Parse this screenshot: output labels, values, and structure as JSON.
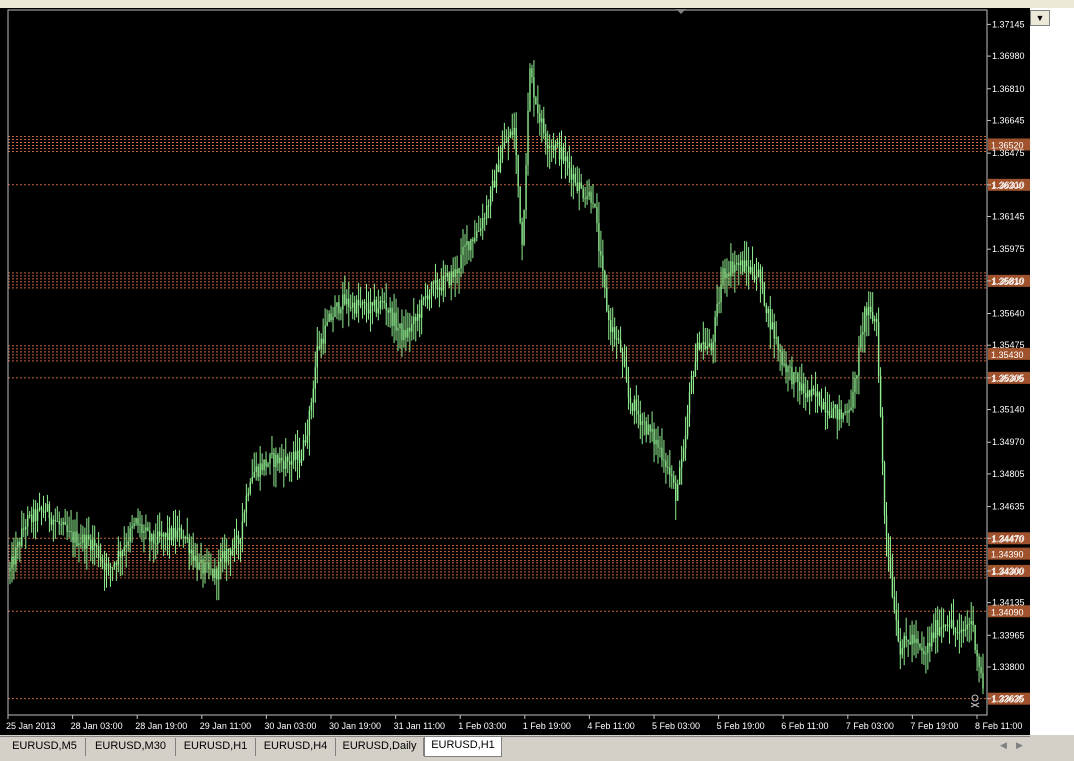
{
  "window": {
    "timeframe_dropdown_icon": "chevron-down-icon"
  },
  "tabs": [
    {
      "label": "EURUSD,M5",
      "active": false
    },
    {
      "label": "EURUSD,M30",
      "active": false
    },
    {
      "label": "EURUSD,H1",
      "active": false
    },
    {
      "label": "EURUSD,H4",
      "active": false
    },
    {
      "label": "EURUSD,Daily",
      "active": false
    },
    {
      "label": "EURUSD,H1",
      "active": true
    }
  ],
  "tab_scroll": {
    "left_icon": "arrow-left-icon",
    "right_icon": "arrow-right-icon"
  },
  "chart_data": {
    "type": "candlestick",
    "symbol": "EURUSD",
    "timeframe": "H1",
    "ylim": [
      1.3355,
      1.3722
    ],
    "y_ticks": [
      1.37145,
      1.3698,
      1.3681,
      1.36645,
      1.36475,
      1.3631,
      1.36145,
      1.35975,
      1.3581,
      1.3564,
      1.35475,
      1.35305,
      1.3514,
      1.3497,
      1.34805,
      1.34635,
      1.3447,
      1.343,
      1.34135,
      1.33965,
      1.338,
      1.33635
    ],
    "y_tick_labels": [
      "1.37145",
      "1.36980",
      "1.36810",
      "1.36645",
      "1.36475",
      "1.36310",
      "1.36145",
      "1.35975",
      "1.35810",
      "1.35640",
      "1.35475",
      "1.35305",
      "1.35140",
      "1.34970",
      "1.34805",
      "1.34635",
      "1.34470",
      "1.34300",
      "1.34135",
      "1.33965",
      "1.33800",
      "1.33635"
    ],
    "x_ticks": [
      "25 Jan 2013",
      "28 Jan 03:00",
      "28 Jan 19:00",
      "29 Jan 11:00",
      "30 Jan 03:00",
      "30 Jan 19:00",
      "31 Jan 11:00",
      "1 Feb 03:00",
      "1 Feb 19:00",
      "4 Feb 11:00",
      "5 Feb 03:00",
      "5 Feb 19:00",
      "6 Feb 11:00",
      "7 Feb 03:00",
      "7 Feb 19:00",
      "8 Feb 11:00"
    ],
    "levels": [
      {
        "price": 1.3652,
        "label": "1.36520",
        "type": "band"
      },
      {
        "price": 1.3631,
        "label": "1.36300",
        "type": "line"
      },
      {
        "price": 1.3581,
        "label": "1.35810",
        "type": "band"
      },
      {
        "price": 1.3543,
        "label": "1.35430",
        "type": "band"
      },
      {
        "price": 1.35305,
        "label": "1.35305",
        "type": "line"
      },
      {
        "price": 1.3447,
        "label": "1.34470",
        "type": "line"
      },
      {
        "price": 1.3439,
        "label": "1.34390",
        "type": "band"
      },
      {
        "price": 1.343,
        "label": "1.34300",
        "type": "band"
      },
      {
        "price": 1.3409,
        "label": "1.34090",
        "type": "line"
      },
      {
        "price": 1.33635,
        "label": "1.33635",
        "type": "line"
      }
    ],
    "path": [
      [
        0,
        1.343
      ],
      [
        8,
        1.3455
      ],
      [
        18,
        1.3462
      ],
      [
        30,
        1.3448
      ],
      [
        42,
        1.3445
      ],
      [
        50,
        1.343
      ],
      [
        56,
        1.344
      ],
      [
        64,
        1.3455
      ],
      [
        72,
        1.3445
      ],
      [
        80,
        1.3448
      ],
      [
        88,
        1.345
      ],
      [
        96,
        1.3432
      ],
      [
        104,
        1.3428
      ],
      [
        110,
        1.344
      ],
      [
        116,
        1.3445
      ],
      [
        122,
        1.348
      ],
      [
        128,
        1.3485
      ],
      [
        134,
        1.3488
      ],
      [
        142,
        1.3487
      ],
      [
        148,
        1.349
      ],
      [
        152,
        1.351
      ],
      [
        156,
        1.3545
      ],
      [
        162,
        1.356
      ],
      [
        168,
        1.357
      ],
      [
        176,
        1.3568
      ],
      [
        184,
        1.3566
      ],
      [
        190,
        1.357
      ],
      [
        196,
        1.3558
      ],
      [
        200,
        1.3552
      ],
      [
        206,
        1.356
      ],
      [
        212,
        1.3575
      ],
      [
        220,
        1.358
      ],
      [
        226,
        1.3585
      ],
      [
        232,
        1.36
      ],
      [
        238,
        1.3608
      ],
      [
        244,
        1.3625
      ],
      [
        250,
        1.365
      ],
      [
        256,
        1.366
      ],
      [
        260,
        1.36
      ],
      [
        264,
        1.369
      ],
      [
        268,
        1.367
      ],
      [
        272,
        1.3655
      ],
      [
        278,
        1.365
      ],
      [
        284,
        1.364
      ],
      [
        290,
        1.3628
      ],
      [
        296,
        1.3625
      ],
      [
        300,
        1.359
      ],
      [
        304,
        1.356
      ],
      [
        310,
        1.3545
      ],
      [
        314,
        1.352
      ],
      [
        320,
        1.351
      ],
      [
        326,
        1.35
      ],
      [
        332,
        1.349
      ],
      [
        338,
        1.347
      ],
      [
        342,
        1.349
      ],
      [
        346,
        1.353
      ],
      [
        350,
        1.355
      ],
      [
        356,
        1.3545
      ],
      [
        362,
        1.3585
      ],
      [
        368,
        1.359
      ],
      [
        374,
        1.3588
      ],
      [
        380,
        1.3584
      ],
      [
        386,
        1.356
      ],
      [
        392,
        1.354
      ],
      [
        398,
        1.353
      ],
      [
        404,
        1.3522
      ],
      [
        410,
        1.352
      ],
      [
        416,
        1.3515
      ],
      [
        422,
        1.351
      ],
      [
        428,
        1.352
      ],
      [
        434,
        1.3565
      ],
      [
        440,
        1.356
      ],
      [
        444,
        1.346
      ],
      [
        448,
        1.342
      ],
      [
        452,
        1.339
      ],
      [
        458,
        1.3395
      ],
      [
        464,
        1.3385
      ],
      [
        470,
        1.34
      ],
      [
        476,
        1.3405
      ],
      [
        482,
        1.3395
      ],
      [
        488,
        1.3405
      ],
      [
        494,
        1.337
      ]
    ],
    "path_x_max": 494
  }
}
